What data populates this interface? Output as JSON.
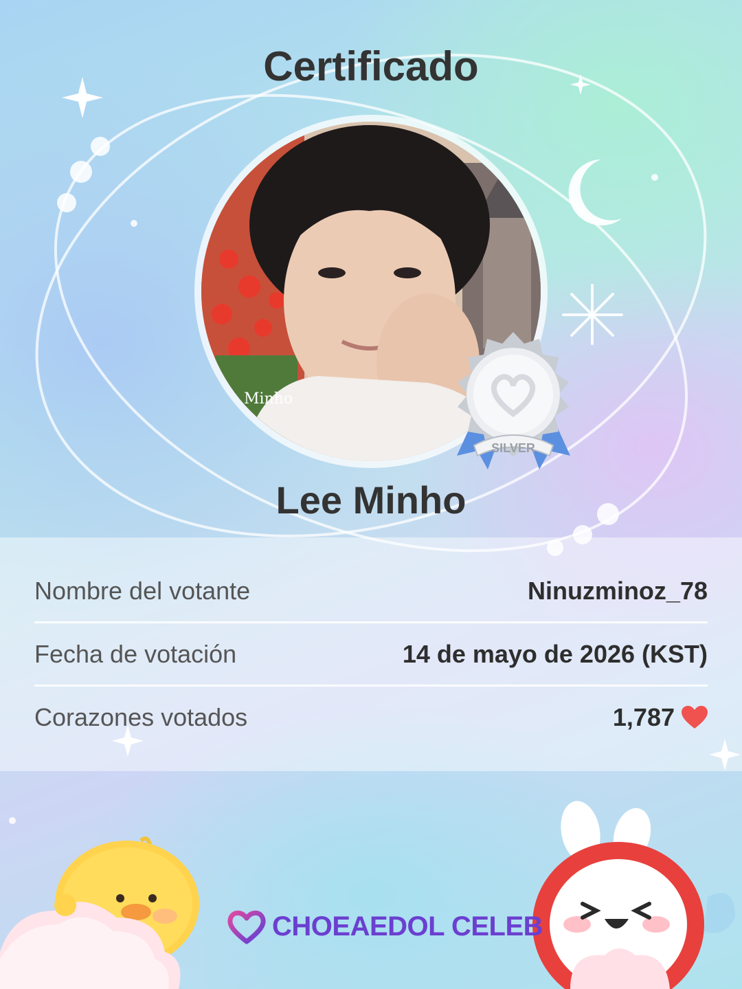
{
  "certificate": {
    "title": "Certificado",
    "celebrity_name": "Lee Minho",
    "photo_watermark": "Minho",
    "badge_tier": "SILVER"
  },
  "details": {
    "rows": [
      {
        "label": "Nombre del votante",
        "value": "Ninuzminoz_78"
      },
      {
        "label": "Fecha de votación",
        "value": "14 de mayo de 2026 (KST)"
      },
      {
        "label": "Corazones votados",
        "value": "1,787"
      }
    ],
    "heart_icon": "heart-icon"
  },
  "brand": {
    "name": "CHOEAEDOL CELEB",
    "logo_icon": "heart-logo-icon"
  },
  "colors": {
    "brand_purple": "#6b3fd0",
    "heart_red": "#f0524f",
    "badge_blue": "#5b8fe0",
    "badge_silver": "#c8ccd3"
  }
}
